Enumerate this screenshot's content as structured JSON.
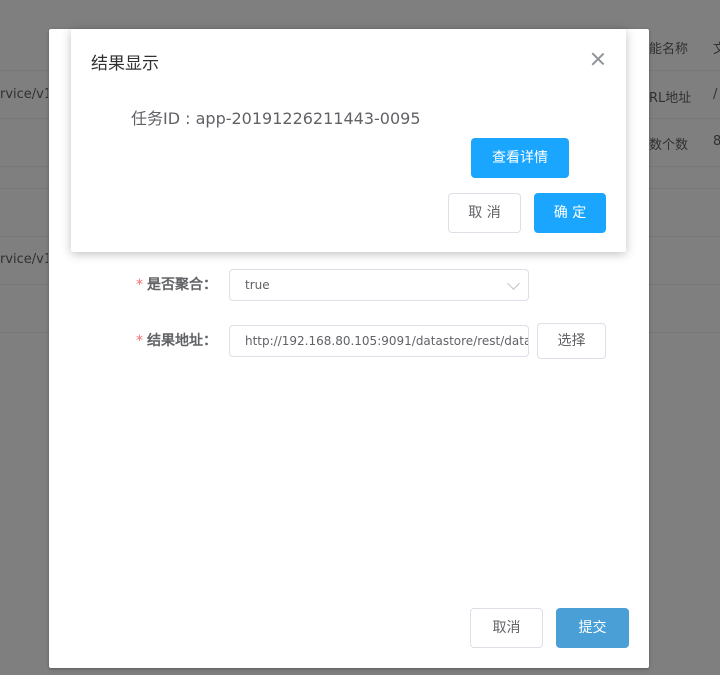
{
  "background_table": {
    "headers": [
      "能名称",
      "文"
    ],
    "rows": [
      {
        "left": "rvice/v1.",
        "right_label": "RL地址",
        "right_value": "/"
      },
      {
        "left": "",
        "right_label": "数个数",
        "right_value": "8"
      },
      {
        "left": "",
        "right_label": "",
        "right_value": ""
      },
      {
        "left": "rvice/v1.",
        "right_label": "",
        "right_value": ""
      },
      {
        "left": "",
        "right_label": "",
        "right_value": ""
      }
    ]
  },
  "form": {
    "aggregate": {
      "label": "是否聚合：",
      "value": "true"
    },
    "result_address": {
      "label": "结果地址：",
      "value": "http://192.168.80.105:9091/datastore/rest/data",
      "select_button": "选择"
    },
    "cancel_button": "取消",
    "submit_button": "提交",
    "required_mark": "*"
  },
  "result_dialog": {
    "title": "结果显示",
    "task_id_text": "任务ID : app-20191226211443-0095",
    "details_button": "查看详情",
    "cancel_button": "取 消",
    "confirm_button": "确 定"
  },
  "colors": {
    "primary": "#1aa6ff",
    "required": "#f56c6c"
  }
}
